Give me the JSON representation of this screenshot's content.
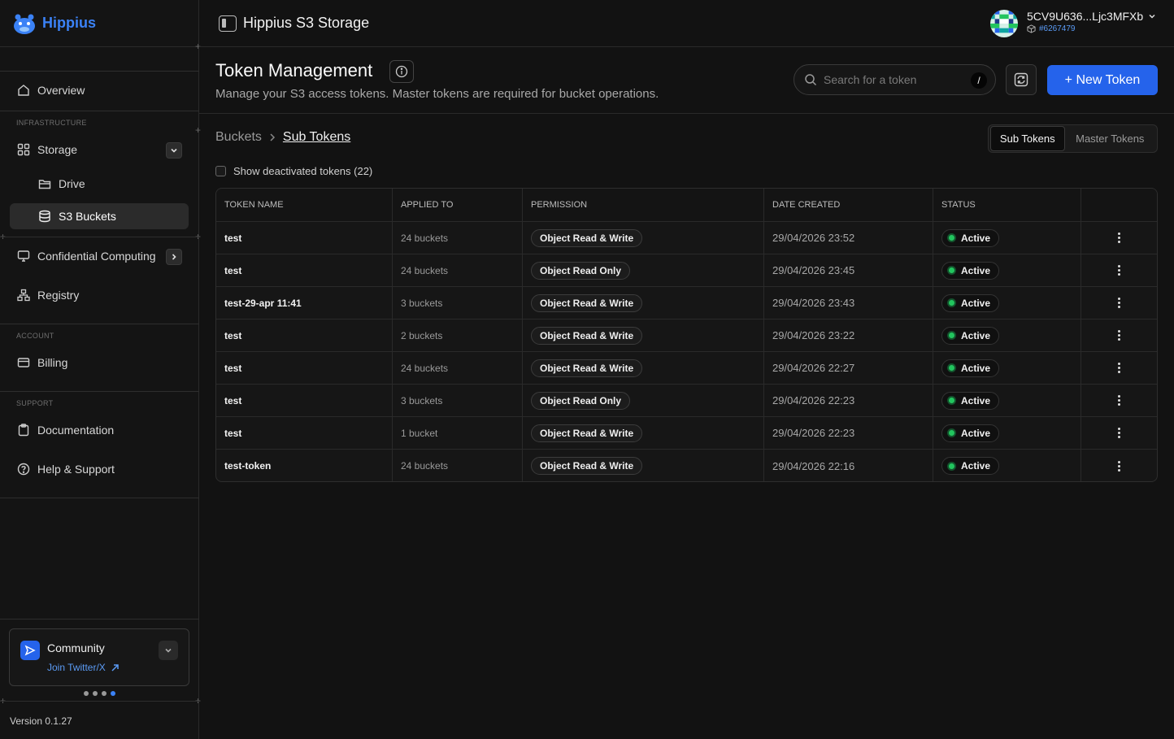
{
  "brand": {
    "name": "Hippius",
    "accent": "#3b82f6"
  },
  "topbar": {
    "title": "Hippius S3 Storage"
  },
  "account": {
    "address": "5CV9U636...Ljc3MFXb",
    "block": "#6267479"
  },
  "sidebar": {
    "overview": "Overview",
    "sections": {
      "infrastructure": "INFRASTRUCTURE",
      "account": "ACCOUNT",
      "support": "SUPPORT"
    },
    "storage": "Storage",
    "drive": "Drive",
    "s3": "S3 Buckets",
    "confidential": "Confidential Computing",
    "registry": "Registry",
    "billing": "Billing",
    "documentation": "Documentation",
    "help": "Help & Support",
    "community": {
      "title": "Community",
      "link": "Join Twitter/X"
    },
    "version": "Version 0.1.27"
  },
  "header": {
    "title": "Token Management",
    "description": "Manage your S3 access tokens. Master tokens are required for bucket operations.",
    "search_placeholder": "Search for a token",
    "search_shortcut": "/",
    "new_button": "+ New Token"
  },
  "breadcrumb": {
    "parent": "Buckets",
    "current": "Sub Tokens"
  },
  "tabs": {
    "sub": "Sub Tokens",
    "master": "Master Tokens"
  },
  "show_deactivated": "Show deactivated tokens (22)",
  "table": {
    "headers": [
      "TOKEN NAME",
      "APPLIED TO",
      "PERMISSION",
      "DATE CREATED",
      "STATUS",
      ""
    ],
    "rows": [
      {
        "name": "test",
        "applied": "24 buckets",
        "permission": "Object Read & Write",
        "date": "29/04/2026 23:52",
        "status": "Active"
      },
      {
        "name": "test",
        "applied": "24 buckets",
        "permission": "Object Read Only",
        "date": "29/04/2026 23:45",
        "status": "Active"
      },
      {
        "name": "test-29-apr 11:41",
        "applied": "3 buckets",
        "permission": "Object Read & Write",
        "date": "29/04/2026 23:43",
        "status": "Active"
      },
      {
        "name": "test",
        "applied": "2 buckets",
        "permission": "Object Read & Write",
        "date": "29/04/2026 23:22",
        "status": "Active"
      },
      {
        "name": "test",
        "applied": "24 buckets",
        "permission": "Object Read & Write",
        "date": "29/04/2026 22:27",
        "status": "Active"
      },
      {
        "name": "test",
        "applied": "3 buckets",
        "permission": "Object Read Only",
        "date": "29/04/2026 22:23",
        "status": "Active"
      },
      {
        "name": "test",
        "applied": "1 bucket",
        "permission": "Object Read & Write",
        "date": "29/04/2026 22:23",
        "status": "Active"
      },
      {
        "name": "test-token",
        "applied": "24 buckets",
        "permission": "Object Read & Write",
        "date": "29/04/2026 22:16",
        "status": "Active"
      }
    ]
  },
  "colors": {
    "primary": "#2563eb",
    "active_dot": "#22c55e",
    "background": "#121212"
  }
}
